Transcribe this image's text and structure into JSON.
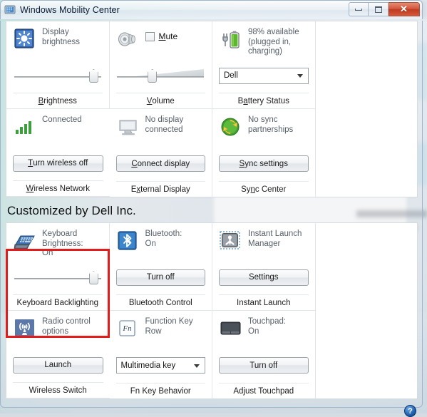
{
  "window": {
    "title": "Windows Mobility Center",
    "icon": "mobility-center-icon",
    "minimize_label": "Minimize",
    "maximize_label": "Maximize",
    "close_label": "✕",
    "help_label": "?"
  },
  "sections": [
    {
      "heading": null,
      "tiles": [
        {
          "id": "display-brightness",
          "icon": "brightness-icon",
          "text": "Display\nbrightness",
          "control": {
            "type": "slider",
            "value": 93
          },
          "footer": "Brightness",
          "footer_accesskey": "B"
        },
        {
          "id": "volume",
          "icon": "speaker-icon",
          "text": "",
          "checkbox": {
            "label": "Mute",
            "accesskey": "M",
            "checked": false
          },
          "control": {
            "type": "slider-wedge",
            "value": 38
          },
          "footer": "Volume",
          "footer_accesskey": "V"
        },
        {
          "id": "battery-status",
          "icon": "battery-charging-icon",
          "text": "98% available\n(plugged in,\ncharging)",
          "control": {
            "type": "combo",
            "value": "Dell"
          },
          "footer": "Battery Status",
          "footer_accesskey": "a"
        },
        {
          "id": "wireless-network",
          "icon": "wifi-signal-icon",
          "text": "Connected",
          "control": {
            "type": "button",
            "label": "Turn wireless off",
            "accesskey": "T"
          },
          "footer": "Wireless Network",
          "footer_accesskey": "W"
        },
        {
          "id": "external-display",
          "icon": "monitor-icon",
          "text": "No display\nconnected",
          "control": {
            "type": "button",
            "label": "Connect display",
            "accesskey": "C"
          },
          "footer": "External Display",
          "footer_accesskey": "x"
        },
        {
          "id": "sync-center",
          "icon": "sync-icon",
          "text": "No sync\npartnerships",
          "control": {
            "type": "button",
            "label": "Sync settings",
            "accesskey": "S"
          },
          "footer": "Sync Center",
          "footer_accesskey": "n"
        }
      ]
    },
    {
      "heading": "Customized by Dell Inc.",
      "tiles": [
        {
          "id": "keyboard-backlighting",
          "icon": "keyboard-backlight-icon",
          "text": "Keyboard\nBrightness:\nOn",
          "control": {
            "type": "slider",
            "value": 93
          },
          "footer": "Keyboard Backlighting",
          "highlighted": true
        },
        {
          "id": "bluetooth-control",
          "icon": "bluetooth-icon",
          "text": "Bluetooth:\nOn",
          "control": {
            "type": "button",
            "label": "Turn off"
          },
          "footer": "Bluetooth Control"
        },
        {
          "id": "instant-launch",
          "icon": "instant-launch-icon",
          "text": "Instant Launch\nManager",
          "control": {
            "type": "button",
            "label": "Settings"
          },
          "footer": "Instant Launch"
        },
        {
          "id": "wireless-switch",
          "icon": "radio-tower-icon",
          "text": "Radio control\noptions",
          "control": {
            "type": "button",
            "label": "Launch"
          },
          "footer": "Wireless Switch"
        },
        {
          "id": "fn-key-behavior",
          "icon": "fn-key-icon",
          "text": "Function Key\nRow",
          "control": {
            "type": "combo",
            "value": "Multimedia key"
          },
          "footer": "Fn Key Behavior"
        },
        {
          "id": "adjust-touchpad",
          "icon": "touchpad-icon",
          "text": "Touchpad:\nOn",
          "control": {
            "type": "button",
            "label": "Turn off"
          },
          "footer": "Adjust Touchpad"
        }
      ]
    }
  ],
  "colors": {
    "highlight": "#e21b1b",
    "titlebar_border": "#9eb6cd",
    "close_button": "#c7402a",
    "battery_green": "#5cb82a",
    "wifi_green": "#3d9e3d",
    "bluetooth_blue": "#2b6fb5",
    "text_gray": "#57606a"
  }
}
